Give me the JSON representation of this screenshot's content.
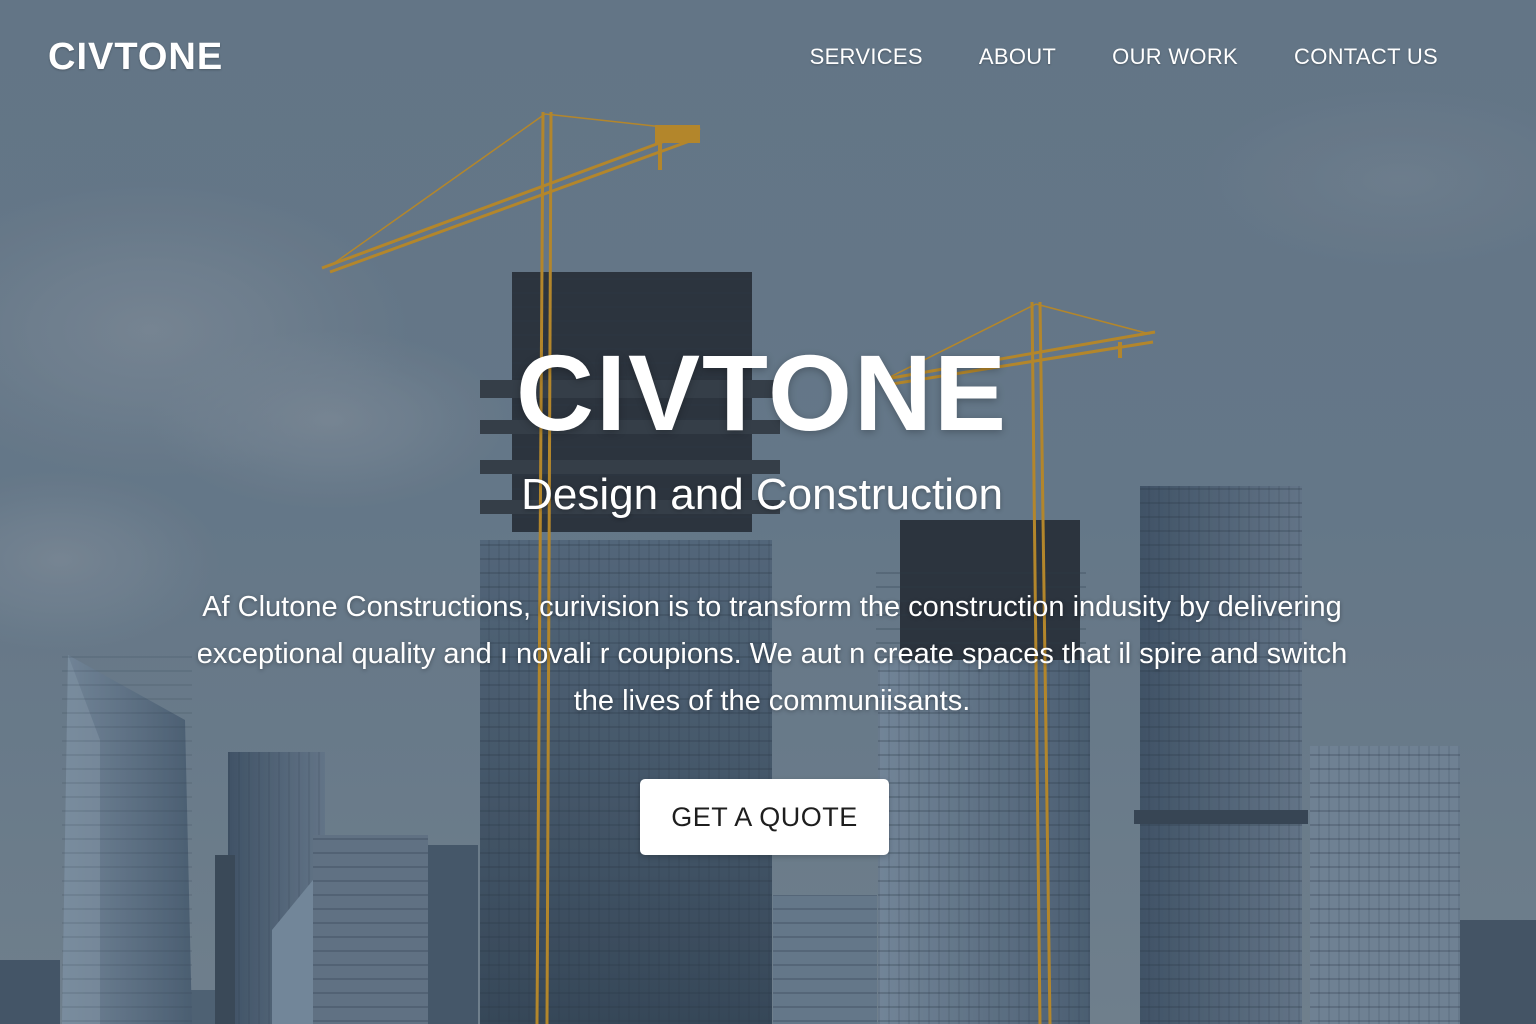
{
  "header": {
    "logo": "CIVTONE",
    "nav": [
      {
        "label": "SERVICES"
      },
      {
        "label": "ABOUT"
      },
      {
        "label": "OUR WORK"
      },
      {
        "label": "CONTACT US"
      }
    ]
  },
  "hero": {
    "title": "CIVTONE",
    "subtitle": "Design and Construction",
    "description": "Af Clutone Constructions, curivision is to transform the construction indusity by delivering exceptional quality and ı novali r coupions. We aut n create spaces that il spire and switch the lives of the communiisants.",
    "cta_label": "GET A QUOTE"
  },
  "colors": {
    "sky": "#6f8294",
    "crane": "#c9952b",
    "text": "#ffffff",
    "button_bg": "#ffffff",
    "button_text": "#1e1e1e"
  }
}
